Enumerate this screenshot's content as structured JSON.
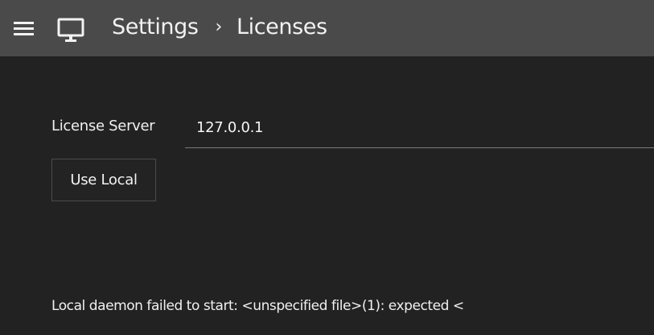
{
  "header": {
    "menu_icon": "hamburger-menu-icon",
    "app_icon": "monitor-icon",
    "breadcrumb": {
      "parent": "Settings",
      "separator": "›",
      "current": "Licenses"
    }
  },
  "license": {
    "label": "License Server",
    "value": "127.0.0.1",
    "use_local_label": "Use Local"
  },
  "status": {
    "message": "Local daemon failed to start: <unspecified file>(1): expected <"
  },
  "colors": {
    "header_bg": "#4a4a4a",
    "page_bg": "#222222",
    "text": "#f0f0f0"
  }
}
